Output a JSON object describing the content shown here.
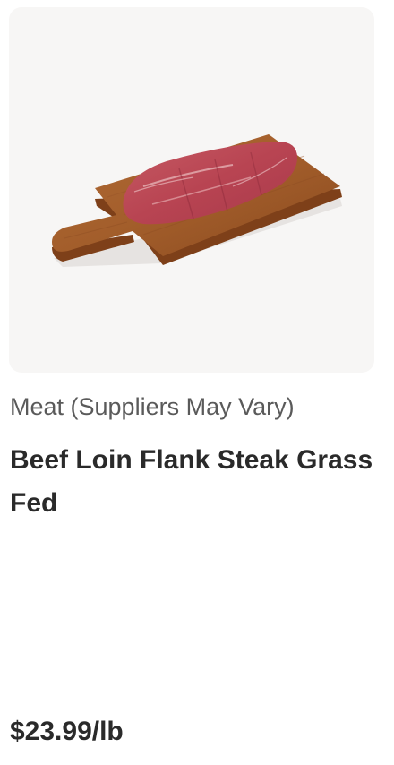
{
  "product": {
    "category": "Meat (Suppliers May Vary)",
    "name": "Beef Loin Flank Steak Grass Fed",
    "price": "$23.99/lb",
    "image": {
      "icon": "flank-steak-on-cutting-board",
      "background_color": "#f7f6f5"
    }
  }
}
